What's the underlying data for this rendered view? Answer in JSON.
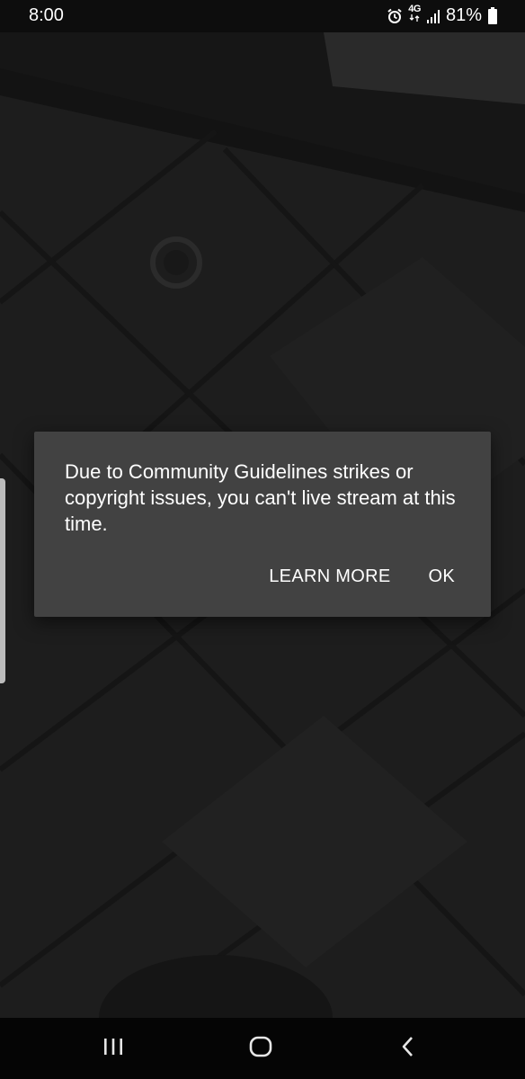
{
  "status_bar": {
    "time": "8:00",
    "network": "4G",
    "battery_percent": "81%",
    "icons": [
      "alarm-icon",
      "network-4g-icon",
      "signal-icon",
      "battery-icon"
    ]
  },
  "dialog": {
    "message": "Due to Community Guidelines strikes or copyright issues, you can't live stream at this time.",
    "learn_more_label": "LEARN MORE",
    "ok_label": "OK"
  },
  "nav_bar": {
    "icons": [
      "recents-icon",
      "home-icon",
      "back-icon"
    ]
  },
  "colors": {
    "dialog_bg": "#424242",
    "background": "#1c1c1c",
    "text": "#ffffff"
  }
}
